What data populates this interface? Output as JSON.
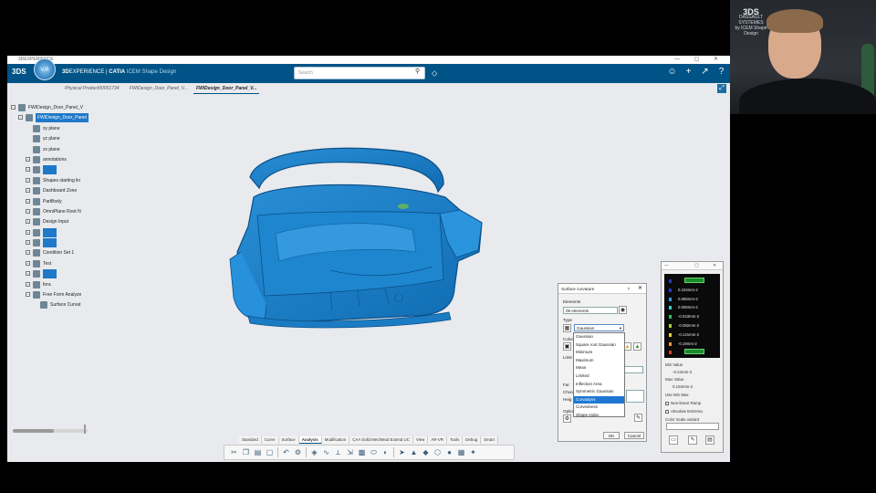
{
  "window": {
    "title": "3DEXPERIENCE",
    "controls": "— ▢ ✕"
  },
  "appbar": {
    "brand_logo": "3DS",
    "compass_label": "V.R",
    "product_prefix": "3D",
    "product_mid": "EXPERIENCE | ",
    "product_app": "CATIA",
    "product_tool": " ICEM Shape Design",
    "search_placeholder": "Search",
    "icons": [
      "user-icon",
      "plus-icon",
      "share-icon",
      "help-icon"
    ]
  },
  "tabs": [
    {
      "label": "Physical Product00001734",
      "active": false
    },
    {
      "label": "FWIDesign_Door_Panel_V...",
      "active": false
    },
    {
      "label": "FWIDesign_Door_Panel_V...",
      "active": true
    }
  ],
  "tree": [
    {
      "label": "FWIDesign_Door_Panel_V",
      "indent": 0,
      "highlight": false,
      "expander": "−"
    },
    {
      "label": "FWIDesign_Door_Panel",
      "indent": 1,
      "highlight": true,
      "highlight_text": true,
      "expander": "−"
    },
    {
      "label": "xy plane",
      "indent": 2,
      "highlight": false,
      "expander": ""
    },
    {
      "label": "yz plane",
      "indent": 2,
      "highlight": false,
      "expander": ""
    },
    {
      "label": "zx plane",
      "indent": 2,
      "highlight": false,
      "expander": ""
    },
    {
      "label": "annotations",
      "indent": 2,
      "highlight": false,
      "expander": "+"
    },
    {
      "label": "",
      "indent": 2,
      "highlight": true,
      "highlight_text": false,
      "expander": "+"
    },
    {
      "label": "Shapes starting lin",
      "indent": 2,
      "highlight": false,
      "expander": "+"
    },
    {
      "label": "Dashboard Zone",
      "indent": 2,
      "highlight": false,
      "expander": "+"
    },
    {
      "label": "PartBody",
      "indent": 2,
      "highlight": false,
      "expander": "+"
    },
    {
      "label": "OmniPlane Root N",
      "indent": 2,
      "highlight": false,
      "expander": "+"
    },
    {
      "label": "Design Input",
      "indent": 2,
      "highlight": false,
      "expander": "+"
    },
    {
      "label": "",
      "indent": 2,
      "highlight": true,
      "highlight_text": false,
      "expander": "+"
    },
    {
      "label": "",
      "indent": 2,
      "highlight": true,
      "highlight_text": false,
      "expander": "+"
    },
    {
      "label": "Condition Set 1",
      "indent": 2,
      "highlight": false,
      "expander": "+"
    },
    {
      "label": "Test",
      "indent": 2,
      "highlight": false,
      "expander": "+"
    },
    {
      "label": "",
      "indent": 2,
      "highlight": true,
      "highlight_text": false,
      "expander": "+"
    },
    {
      "label": "fora",
      "indent": 2,
      "highlight": false,
      "expander": "+"
    },
    {
      "label": "Free Form Analyze",
      "indent": 2,
      "highlight": false,
      "expander": "−"
    },
    {
      "label": "Surface Curvat",
      "indent": 3,
      "highlight": false,
      "expander": ""
    }
  ],
  "curvature_dialog": {
    "title": "Surface curvature",
    "help": "?",
    "close": "✕",
    "elements_label": "Elements",
    "elements_value": "08 elements",
    "type_label": "Type",
    "type_value": "Gaussian",
    "color_label": "Color",
    "limit_label": "Limit",
    "far_label": "Far",
    "choose_label": "Choo",
    "height_label": "Heig",
    "options_label": "Optio",
    "type_options": [
      {
        "label": "Gaussian",
        "selected": false
      },
      {
        "label": "Square root Gaussian",
        "selected": false
      },
      {
        "label": "Minimum",
        "selected": false
      },
      {
        "label": "Maximum",
        "selected": false
      },
      {
        "label": "Mean",
        "selected": false
      },
      {
        "label": "Limited",
        "selected": false
      },
      {
        "label": "Inflection Area",
        "selected": false
      },
      {
        "label": "Symmetric Gaussian",
        "selected": false
      },
      {
        "label": "Curvadyns",
        "selected": true
      },
      {
        "label": "Curvedness",
        "selected": false
      },
      {
        "label": "Shape Index",
        "selected": false
      }
    ],
    "ok": "OK",
    "cancel": "Cancel"
  },
  "color_scale": {
    "header_icons": [
      "—",
      "▢",
      "✕"
    ],
    "rows": [
      {
        "value": "",
        "color": "#1b3cc8",
        "bar": true
      },
      {
        "value": "0.104mm-2",
        "color": "#1b3cc8",
        "bar": false
      },
      {
        "value": "0.055mm-2",
        "color": "#2b9fe6",
        "bar": false
      },
      {
        "value": "0.006mm-2",
        "color": "#2bd3d8",
        "bar": false
      },
      {
        "value": "-0.043mm-2",
        "color": "#29c15a",
        "bar": false
      },
      {
        "value": "-0.092mm-2",
        "color": "#a5d830",
        "bar": false
      },
      {
        "value": "-0.141mm-2",
        "color": "#e8d629",
        "bar": false
      },
      {
        "value": "-0.19mm-2",
        "color": "#f29628",
        "bar": false
      },
      {
        "value": "",
        "color": "#e23b2b",
        "bar": true
      }
    ],
    "min_label": "Min Value",
    "min_value": "-0.24mm-2",
    "max_label": "Max Value",
    "max_value": "0.153mm-2",
    "use_min_max": "Use Min Max",
    "non_linear_ramp": "Non-linear Ramp",
    "absolute_extrema": "Absolute Extrema",
    "variant_label": "Color Scale variant"
  },
  "section_tabs": [
    {
      "label": "Standard",
      "active": false
    },
    {
      "label": "Curve",
      "active": false
    },
    {
      "label": "Surface",
      "active": false
    },
    {
      "label": "Analysis",
      "active": true
    },
    {
      "label": "Modification",
      "active": false
    },
    {
      "label": "CAA Solid MechMod Extend UC",
      "active": false
    },
    {
      "label": "View",
      "active": false
    },
    {
      "label": "AR-VR",
      "active": false
    },
    {
      "label": "Tools",
      "active": false
    },
    {
      "label": "Debug",
      "active": false
    },
    {
      "label": "Smart",
      "active": false
    }
  ],
  "actionbar_icons": [
    "scissors-icon",
    "copy-icon",
    "paste-icon",
    "clipboard-icon",
    "undo-icon",
    "gear-icon",
    "analysis-icon",
    "curve-icon",
    "measure-icon",
    "dimension-icon",
    "mesh-icon",
    "cylinder-icon",
    "shade-icon",
    "arrow-icon",
    "triangle-icon",
    "cube-icon",
    "wireframe-icon",
    "sphere-icon",
    "grid-icon",
    "settings-icon"
  ],
  "presenter": {
    "brand_logo": "DASSAULT SYSTEMES",
    "brand_sub": "by ICEM Shape Design"
  },
  "progress": 0.55
}
